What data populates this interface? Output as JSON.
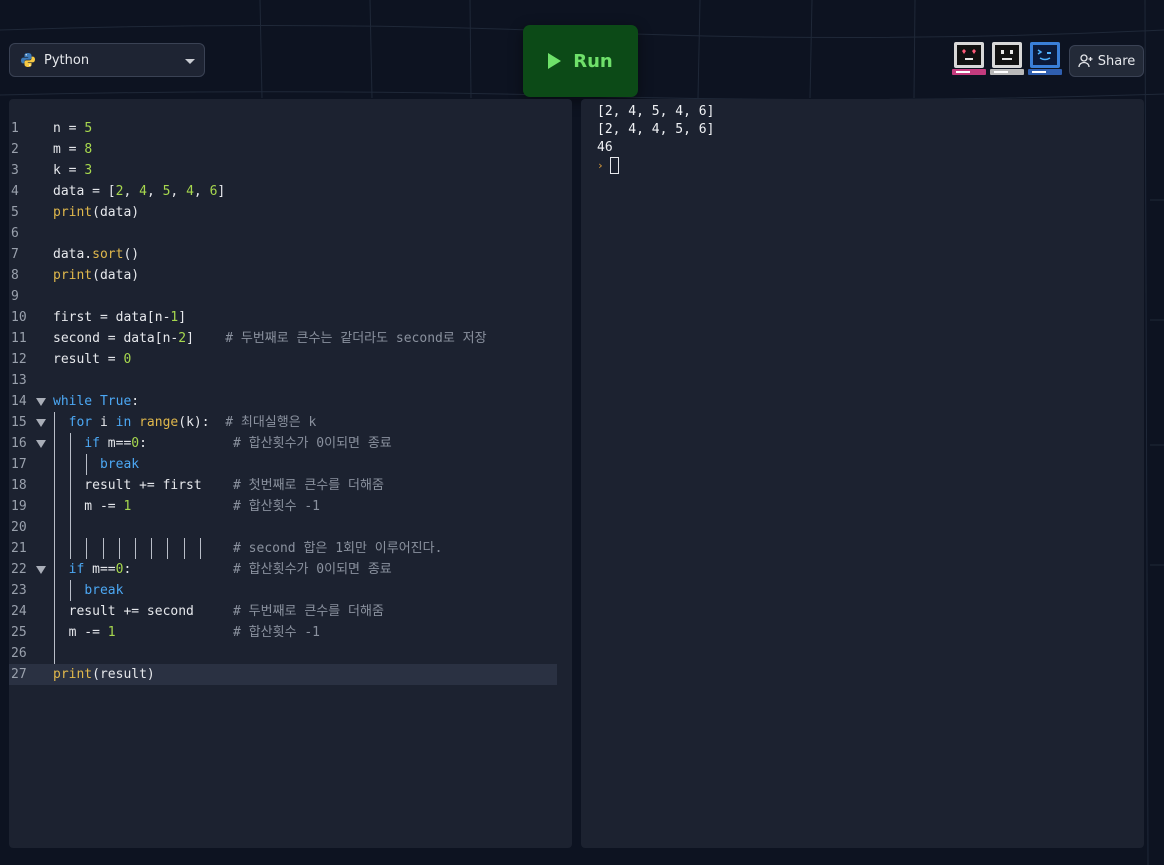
{
  "toolbar": {
    "language": "Python",
    "run_label": "Run",
    "share_label": "Share"
  },
  "colors": {
    "run_bg": "#0c4a17",
    "run_fg": "#6fe06a",
    "panel_bg": "#1c2230",
    "page_bg": "#0d1321"
  },
  "editor": {
    "lines": [
      {
        "n": "1",
        "text": "n = 5"
      },
      {
        "n": "2",
        "text": "m = 8"
      },
      {
        "n": "3",
        "text": "k = 3"
      },
      {
        "n": "4",
        "text": "data = [2, 4, 5, 4, 6]"
      },
      {
        "n": "5",
        "text": "print(data)"
      },
      {
        "n": "6",
        "text": ""
      },
      {
        "n": "7",
        "text": "data.sort()"
      },
      {
        "n": "8",
        "text": "print(data)"
      },
      {
        "n": "9",
        "text": ""
      },
      {
        "n": "10",
        "text": "first = data[n-1]"
      },
      {
        "n": "11",
        "text": "second = data[n-2]    # 두번째로 큰수는 같더라도 second로 저장"
      },
      {
        "n": "12",
        "text": "result = 0"
      },
      {
        "n": "13",
        "text": ""
      },
      {
        "n": "14",
        "text": "while True:"
      },
      {
        "n": "15",
        "text": "  for i in range(k):  # 최대실행은 k"
      },
      {
        "n": "16",
        "text": "    if m==0:           # 합산횟수가 0이되면 종료"
      },
      {
        "n": "17",
        "text": "      break"
      },
      {
        "n": "18",
        "text": "    result += first    # 첫번째로 큰수를 더해줌"
      },
      {
        "n": "19",
        "text": "    m -= 1             # 합산횟수 -1"
      },
      {
        "n": "20",
        "text": ""
      },
      {
        "n": "21",
        "text": "                       # second 합은 1회만 이루어진다."
      },
      {
        "n": "22",
        "text": "  if m==0:             # 합산횟수가 0이되면 종료"
      },
      {
        "n": "23",
        "text": "    break"
      },
      {
        "n": "24",
        "text": "  result += second     # 두번째로 큰수를 더해줌"
      },
      {
        "n": "25",
        "text": "  m -= 1               # 합산횟수 -1"
      },
      {
        "n": "26",
        "text": ""
      },
      {
        "n": "27",
        "text": "print(result)"
      }
    ]
  },
  "console": {
    "lines": [
      "[2, 4, 5, 4, 6]",
      "[2, 4, 4, 5, 6]",
      "46"
    ],
    "prompt": "›"
  }
}
